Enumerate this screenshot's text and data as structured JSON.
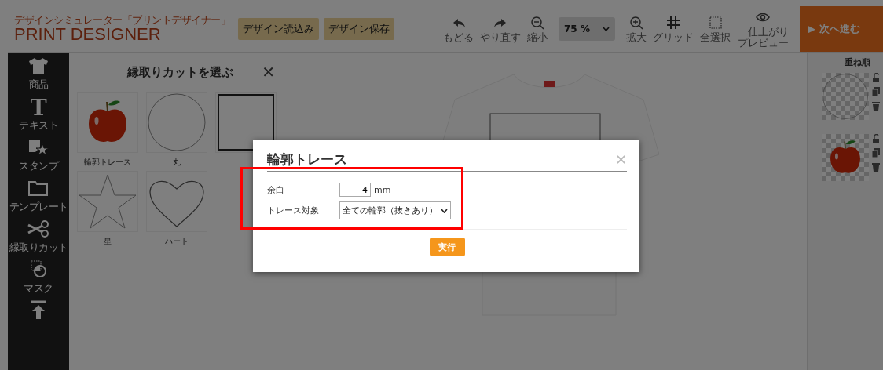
{
  "header": {
    "logo_subtitle": "デザインシミュレーター「プリントデザイナー」",
    "logo": "PRINT DESIGNER",
    "buttons": [
      "デザイン読込み",
      "デザイン保存"
    ],
    "tools_left": [
      {
        "kind": "undo",
        "label": "もどる"
      },
      {
        "kind": "redo",
        "label": "やり直す"
      },
      {
        "kind": "zoom_out",
        "label": "縮小"
      }
    ],
    "zoom": {
      "value": "75 %"
    },
    "tools_right": [
      {
        "kind": "zoom_in",
        "label": "拡大"
      },
      {
        "kind": "grid",
        "label": "グリッド"
      },
      {
        "kind": "select_all",
        "label": "全選択"
      },
      {
        "kind": "preview",
        "label": "仕上がりプレビュー"
      }
    ],
    "next_button": {
      "arrow": "▶",
      "label": "次へ進む"
    }
  },
  "sidebar": {
    "items": [
      {
        "kind": "shirt",
        "label": "商品"
      },
      {
        "kind": "text",
        "glyph": "T",
        "label": "テキスト"
      },
      {
        "kind": "stamp",
        "label": "スタンプ"
      },
      {
        "kind": "folder",
        "label": "テンプレート"
      },
      {
        "kind": "scissors",
        "label": "縁取りカット"
      },
      {
        "kind": "mask",
        "label": "マスク"
      },
      {
        "kind": "upload"
      }
    ]
  },
  "panel": {
    "title": "縁取りカットを選ぶ",
    "close": "✕",
    "shapes": [
      {
        "kind": "apple",
        "label": "輪郭トレース"
      },
      {
        "kind": "circle",
        "label": "丸"
      },
      {
        "kind": "square"
      },
      {
        "kind": "star",
        "label": "星"
      },
      {
        "kind": "heart",
        "label": "ハート"
      }
    ]
  },
  "layers": {
    "title": "重ね順",
    "items": [
      {
        "kind": "circle"
      },
      {
        "kind": "apple"
      }
    ]
  },
  "dialog": {
    "title": "輪郭トレース",
    "close": "✕",
    "fields": [
      {
        "kind": "number",
        "label": "余白",
        "value": "4",
        "unit": "mm"
      },
      {
        "kind": "select",
        "label": "トレース対象",
        "value": "全ての輪郭（抜きあり）"
      }
    ],
    "button": "実行",
    "highlighted": true
  }
}
